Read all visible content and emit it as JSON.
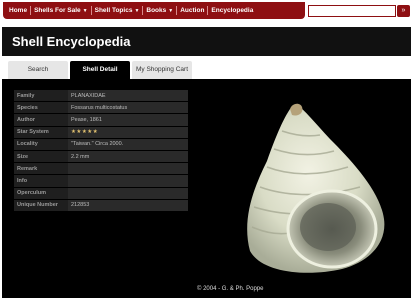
{
  "nav": {
    "items": [
      {
        "label": "Home",
        "caret": ""
      },
      {
        "label": "Shells For Sale",
        "caret": "▼"
      },
      {
        "label": "Shell Topics",
        "caret": "▼"
      },
      {
        "label": "Books",
        "caret": "▼"
      },
      {
        "label": "Auction",
        "caret": ""
      },
      {
        "label": "Encyclopedia",
        "caret": ""
      }
    ],
    "search_value": "",
    "search_button": "»"
  },
  "page_title": "Shell Encyclopedia",
  "tabs": [
    {
      "label": "Search"
    },
    {
      "label": "Shell Detail"
    },
    {
      "label": "My Shopping Cart"
    }
  ],
  "details": [
    {
      "label": "Family",
      "value": "PLANAXIDAE"
    },
    {
      "label": "Species",
      "value": "Fossarus multicostatus"
    },
    {
      "label": "Author",
      "value": "Pease, 1861"
    },
    {
      "label": "Star System",
      "value": "★★★★★"
    },
    {
      "label": "Locality",
      "value": "\"Taiwan.\" Circa 2000."
    },
    {
      "label": "Size",
      "value": "2.2 mm"
    },
    {
      "label": "Remark",
      "value": ""
    },
    {
      "label": "Info",
      "value": ""
    },
    {
      "label": "Operculum",
      "value": ""
    },
    {
      "label": "Unique Number",
      "value": "212853"
    }
  ],
  "copyright": "© 2004 - G. & Ph. Poppe",
  "colors": {
    "brand": "#8e0f12",
    "panel": "#000000",
    "stars": "#e0c070"
  }
}
